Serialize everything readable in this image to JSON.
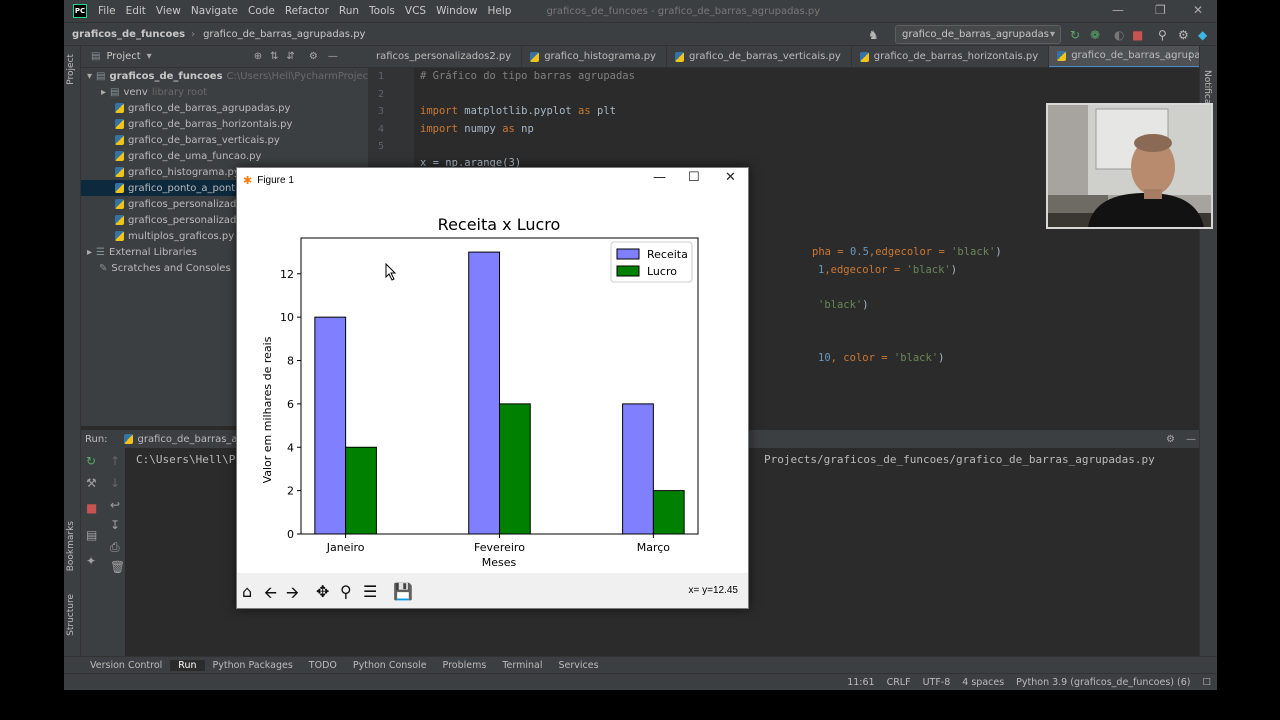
{
  "menubar": {
    "logo": "PC",
    "items": [
      "File",
      "Edit",
      "View",
      "Navigate",
      "Code",
      "Refactor",
      "Run",
      "Tools",
      "VCS",
      "Window",
      "Help"
    ],
    "window_title": "graficos_de_funcoes - grafico_de_barras_agrupadas.py"
  },
  "navbar": {
    "project": "graficos_de_funcoes",
    "file": "grafico_de_barras_agrupadas.py",
    "run_config": "grafico_de_barras_agrupadas"
  },
  "project_panel": {
    "title": "Project",
    "root_name": "graficos_de_funcoes",
    "root_path": "C:\\Users\\Hell\\PycharmProjects\\grafic",
    "venv_name": "venv",
    "venv_hint": "library root",
    "files": [
      "grafico_de_barras_agrupadas.py",
      "grafico_de_barras_horizontais.py",
      "grafico_de_barras_verticais.py",
      "grafico_de_uma_funcao.py",
      "grafico_histograma.py",
      "grafico_ponto_a_ponto.py",
      "graficos_personalizados.p",
      "graficos_personalizados2",
      "multiplos_graficos.py"
    ],
    "external": "External Libraries",
    "scratches": "Scratches and Consoles"
  },
  "editor_tabs": [
    "raficos_personalizados2.py",
    "grafico_histograma.py",
    "grafico_de_barras_verticais.py",
    "grafico_de_barras_horizontais.py",
    "grafico_de_barras_agrupadas.py"
  ],
  "code": {
    "line_numbers": [
      "1",
      "2",
      "3",
      "4",
      "5"
    ],
    "l1": "# Gráfico do tipo barras agrupadas",
    "l3_kw": "import",
    "l3_rest": " matplotlib.pyplot ",
    "l3_as": "as",
    "l3_alias": " plt",
    "l4_kw": "import",
    "l4_rest": " numpy ",
    "l4_as": "as",
    "l4_alias": " np",
    "l5": "x = np.arange(3)",
    "r1_a": "pha = ",
    "r1_b": "0.5",
    "r1_c": ",edgecolor = ",
    "r1_d": "'black'",
    "r1_e": ")",
    "r2_a": "1",
    "r2_b": ",edgecolor = ",
    "r2_c": "'black'",
    "r2_d": ")",
    "r3_a": "'black'",
    "r3_b": ")",
    "r4_a": "10",
    "r4_b": ", color = ",
    "r4_c": "'black'",
    "r4_d": ")"
  },
  "run_panel": {
    "label": "Run:",
    "tab": "grafico_de_barras_agrup",
    "line1_left": "C:\\Users\\Hell\\Py",
    "line1_right": "Projects/graficos_de_funcoes/grafico_de_barras_agrupadas.py"
  },
  "toolwindows": [
    "Version Control",
    "Run",
    "Python Packages",
    "TODO",
    "Python Console",
    "Problems",
    "Terminal",
    "Services"
  ],
  "status": {
    "position": "11:61",
    "line_sep": "CRLF",
    "encoding": "UTF-8",
    "indent": "4 spaces",
    "interpreter": "Python 3.9 (graficos_de_funcoes) (6)"
  },
  "side_tabs": {
    "project": "Project",
    "bookmarks": "Bookmarks",
    "structure": "Structure",
    "notifications": "Notifications"
  },
  "figure": {
    "window_title": "Figure 1",
    "coords": "x= y=12.45",
    "icons": [
      "home-icon",
      "back-arrow-icon",
      "forward-arrow-icon",
      "pan-icon",
      "zoom-icon",
      "configure-subplots-icon",
      "save-icon"
    ]
  },
  "chart_data": {
    "type": "bar",
    "title": "Receita x Lucro",
    "xlabel": "Meses",
    "ylabel": "Valor em milhares de reais",
    "categories": [
      "Janeiro",
      "Fevereiro",
      "Março"
    ],
    "series": [
      {
        "name": "Receita",
        "values": [
          10,
          13,
          6
        ],
        "color": "#8080ff"
      },
      {
        "name": "Lucro",
        "values": [
          4,
          6,
          2
        ],
        "color": "#008000"
      }
    ],
    "yticks": [
      0,
      2,
      4,
      6,
      8,
      10,
      12
    ],
    "ylim": [
      0,
      13.65
    ],
    "legend": "top-right",
    "grid": false
  }
}
